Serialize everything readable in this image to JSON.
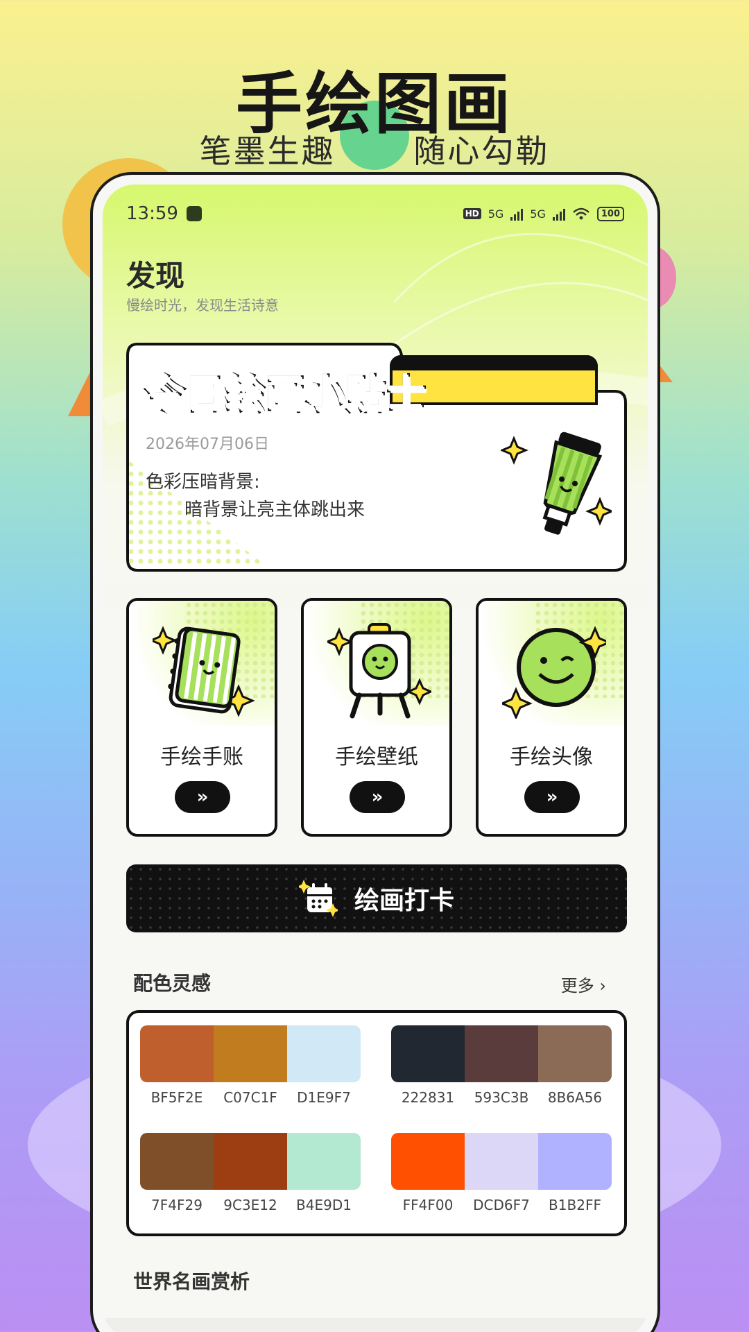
{
  "promo": {
    "title": "手绘图画",
    "subtitle": "笔墨生趣   随心勾勒"
  },
  "status_bar": {
    "time": "13:59",
    "battery": "100",
    "network": "5G"
  },
  "header": {
    "title": "发现",
    "subtitle": "慢绘时光，发现生活诗意"
  },
  "tip": {
    "heading": "今日绘画小贴士",
    "date": "2026年07月06日",
    "label": "色彩压暗背景:",
    "text": "暗背景让亮主体跳出来"
  },
  "features": [
    {
      "label": "手绘手账",
      "icon": "notebook-icon"
    },
    {
      "label": "手绘壁纸",
      "icon": "easel-icon"
    },
    {
      "label": "手绘头像",
      "icon": "smiley-icon"
    }
  ],
  "checkin": {
    "label": "绘画打卡",
    "icon": "calendar-icon"
  },
  "palettes_section": {
    "title": "配色灵感",
    "more": "更多"
  },
  "palettes": [
    [
      "BF5F2E",
      "C07C1F",
      "D1E9F7"
    ],
    [
      "222831",
      "593C3B",
      "8B6A56"
    ],
    [
      "7F4F29",
      "9C3E12",
      "B4E9D1"
    ],
    [
      "FF4F00",
      "DCD6F7",
      "B1B2FF"
    ]
  ],
  "masterpieces_section": {
    "title": "世界名画赏析"
  },
  "colors": {
    "accent_green": "#a7e05a",
    "accent_yellow": "#fee341",
    "dark": "#111111"
  }
}
